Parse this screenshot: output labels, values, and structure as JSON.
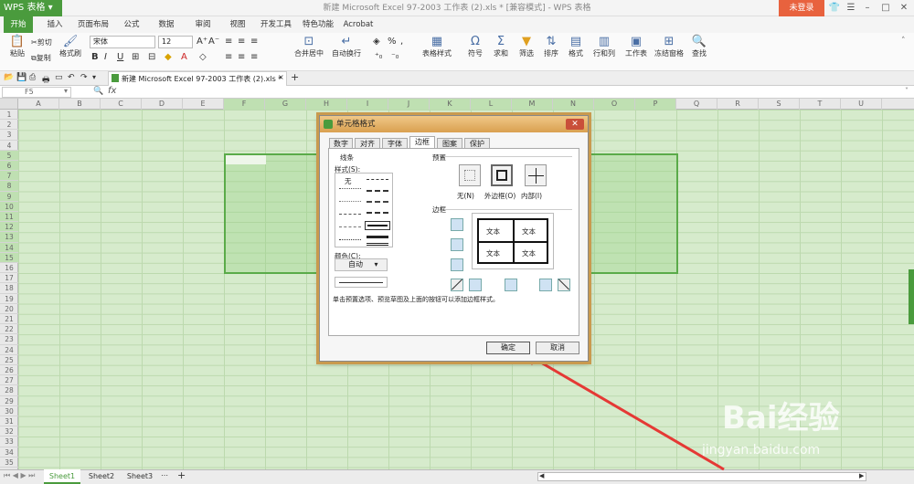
{
  "app": {
    "name": "WPS 表格",
    "window_title": "新建 Microsoft Excel 97-2003 工作表 (2).xls * [兼容模式] - WPS 表格",
    "login": "未登录"
  },
  "menu_tabs": [
    "开始",
    "插入",
    "页面布局",
    "公式",
    "数据",
    "审阅",
    "视图",
    "开发工具",
    "特色功能",
    "Acrobat"
  ],
  "ribbon": {
    "paste": "粘贴",
    "cut": "剪切",
    "copy": "复制",
    "format_painter": "格式刷",
    "font": "宋体",
    "size": "12",
    "merge": "合并居中",
    "wrap": "自动换行",
    "percent": "%",
    "table_style": "表格样式",
    "symbol": "符号",
    "sum": "求和",
    "filter": "筛选",
    "sort": "排序",
    "format": "格式",
    "rowcol": "行和列",
    "sheet": "工作表",
    "freeze": "冻结窗格",
    "find": "查找"
  },
  "doc_tab": "新建 Microsoft Excel 97-2003 工作表 (2).xls *",
  "name_box": "F5",
  "fx": "fx",
  "columns": [
    "A",
    "B",
    "C",
    "D",
    "E",
    "F",
    "G",
    "H",
    "I",
    "J",
    "K",
    "L",
    "M",
    "N",
    "O",
    "P",
    "Q",
    "R",
    "S",
    "T",
    "U"
  ],
  "rows": [
    "1",
    "2",
    "3",
    "4",
    "5",
    "6",
    "7",
    "8",
    "9",
    "10",
    "11",
    "12",
    "13",
    "14",
    "15",
    "16",
    "17",
    "18",
    "19",
    "20",
    "21",
    "22",
    "23",
    "24",
    "25",
    "26",
    "27",
    "28",
    "29",
    "30",
    "31",
    "32",
    "33",
    "34",
    "35"
  ],
  "sheets": [
    "Sheet1",
    "Sheet2",
    "Sheet3"
  ],
  "dialog": {
    "title": "单元格格式",
    "tabs": [
      "数字",
      "对齐",
      "字体",
      "边框",
      "图案",
      "保护"
    ],
    "active_tab": "边框",
    "line_group": "线条",
    "style_label": "样式(S):",
    "none_style": "无",
    "color_label": "颜色(C):",
    "color_value": "自动",
    "preset_group": "预置",
    "preset_none": "无(N)",
    "preset_outline": "外边框(O)",
    "preset_inside": "内部(I)",
    "border_group": "边框",
    "preview_text": "文本",
    "hint": "单击预置选项、预览草图及上面的按钮可以添加边框样式。",
    "ok": "确定",
    "cancel": "取消"
  },
  "watermark": {
    "brand": "Bai经验",
    "url": "jingyan.baidu.com"
  }
}
